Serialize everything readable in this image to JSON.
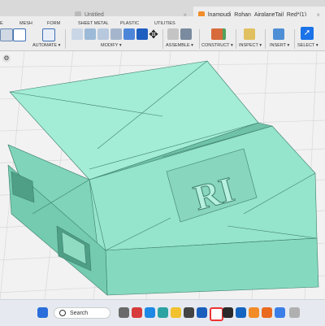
{
  "browser": {
    "tabs": [
      {
        "label": "Untitled",
        "close": "×"
      },
      {
        "label": "lnampudi_Rohan_AirplaneTail_Red*(1)",
        "close": "×"
      }
    ]
  },
  "workspace_tabs": [
    "E",
    "MESH",
    "FORM",
    "SHEET METAL",
    "PLASTIC",
    "UTILITIES"
  ],
  "tool_groups": [
    {
      "label": "AUTOMATE ▾"
    },
    {
      "label": "MODIFY ▾"
    },
    {
      "label": "ASSEMBLE ▾"
    },
    {
      "label": "CONSTRUCT ▾"
    },
    {
      "label": "INSPECT ▾"
    },
    {
      "label": "INSERT ▾"
    },
    {
      "label": "SELECT ▾"
    }
  ],
  "model": {
    "emboss_text": "RI"
  },
  "taskbar": {
    "search_placeholder": "Search"
  },
  "colors": {
    "model": "#8fe0c8",
    "accent_blue": "#1a73e8",
    "toolbar": "#ededed"
  }
}
